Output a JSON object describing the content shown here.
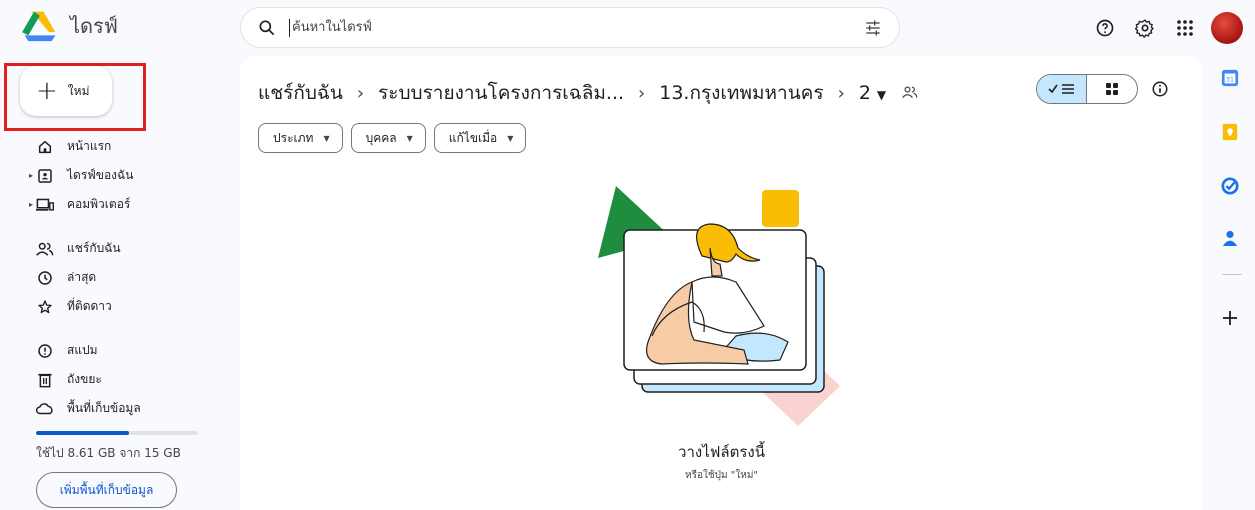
{
  "app": {
    "title": "ไดรฟ์"
  },
  "search": {
    "placeholder": "ค้นหาในไดรฟ์"
  },
  "new_button": {
    "label": "ใหม่"
  },
  "sidebar": {
    "items": [
      {
        "label": "หน้าแรก",
        "icon": "home-icon",
        "expandable": false
      },
      {
        "label": "ไดรฟ์ของฉัน",
        "icon": "my-drive-icon",
        "expandable": true
      },
      {
        "label": "คอมพิวเตอร์",
        "icon": "computer-icon",
        "expandable": true
      },
      {
        "label": "แชร์กับฉัน",
        "icon": "shared-people-icon",
        "expandable": false
      },
      {
        "label": "ล่าสุด",
        "icon": "clock-icon",
        "expandable": false
      },
      {
        "label": "ที่ติดดาว",
        "icon": "star-icon",
        "expandable": false
      },
      {
        "label": "สแปม",
        "icon": "spam-icon",
        "expandable": false
      },
      {
        "label": "ถังขยะ",
        "icon": "trash-icon",
        "expandable": false
      },
      {
        "label": "พื้นที่เก็บข้อมูล",
        "icon": "cloud-icon",
        "expandable": false
      }
    ],
    "storage": {
      "used_text": "ใช้ไป 8.61 GB จาก 15 GB",
      "fraction_used": 0.574,
      "button": "เพิ่มพื้นที่เก็บข้อมูล"
    }
  },
  "breadcrumb": {
    "crumbs": [
      "แชร์กับฉัน",
      "ระบบรายงานโครงการเฉลิม...",
      "13.กรุงเทพมหานคร",
      "2"
    ]
  },
  "filters": [
    "ประเภท",
    "บุคคล",
    "แก้ไขเมื่อ"
  ],
  "empty_state": {
    "title": "วางไฟล์ตรงนี้",
    "subtitle": "หรือใช้ปุ่ม \"ใหม่\""
  },
  "side_apps": [
    "calendar-icon",
    "keep-icon",
    "tasks-icon",
    "contacts-icon",
    "add-icon"
  ],
  "colors": {
    "accent_blue": "#0b57d0",
    "selected_blue": "#c2e7ff",
    "highlight_red": "#e02020",
    "bg": "#f8fafd"
  }
}
